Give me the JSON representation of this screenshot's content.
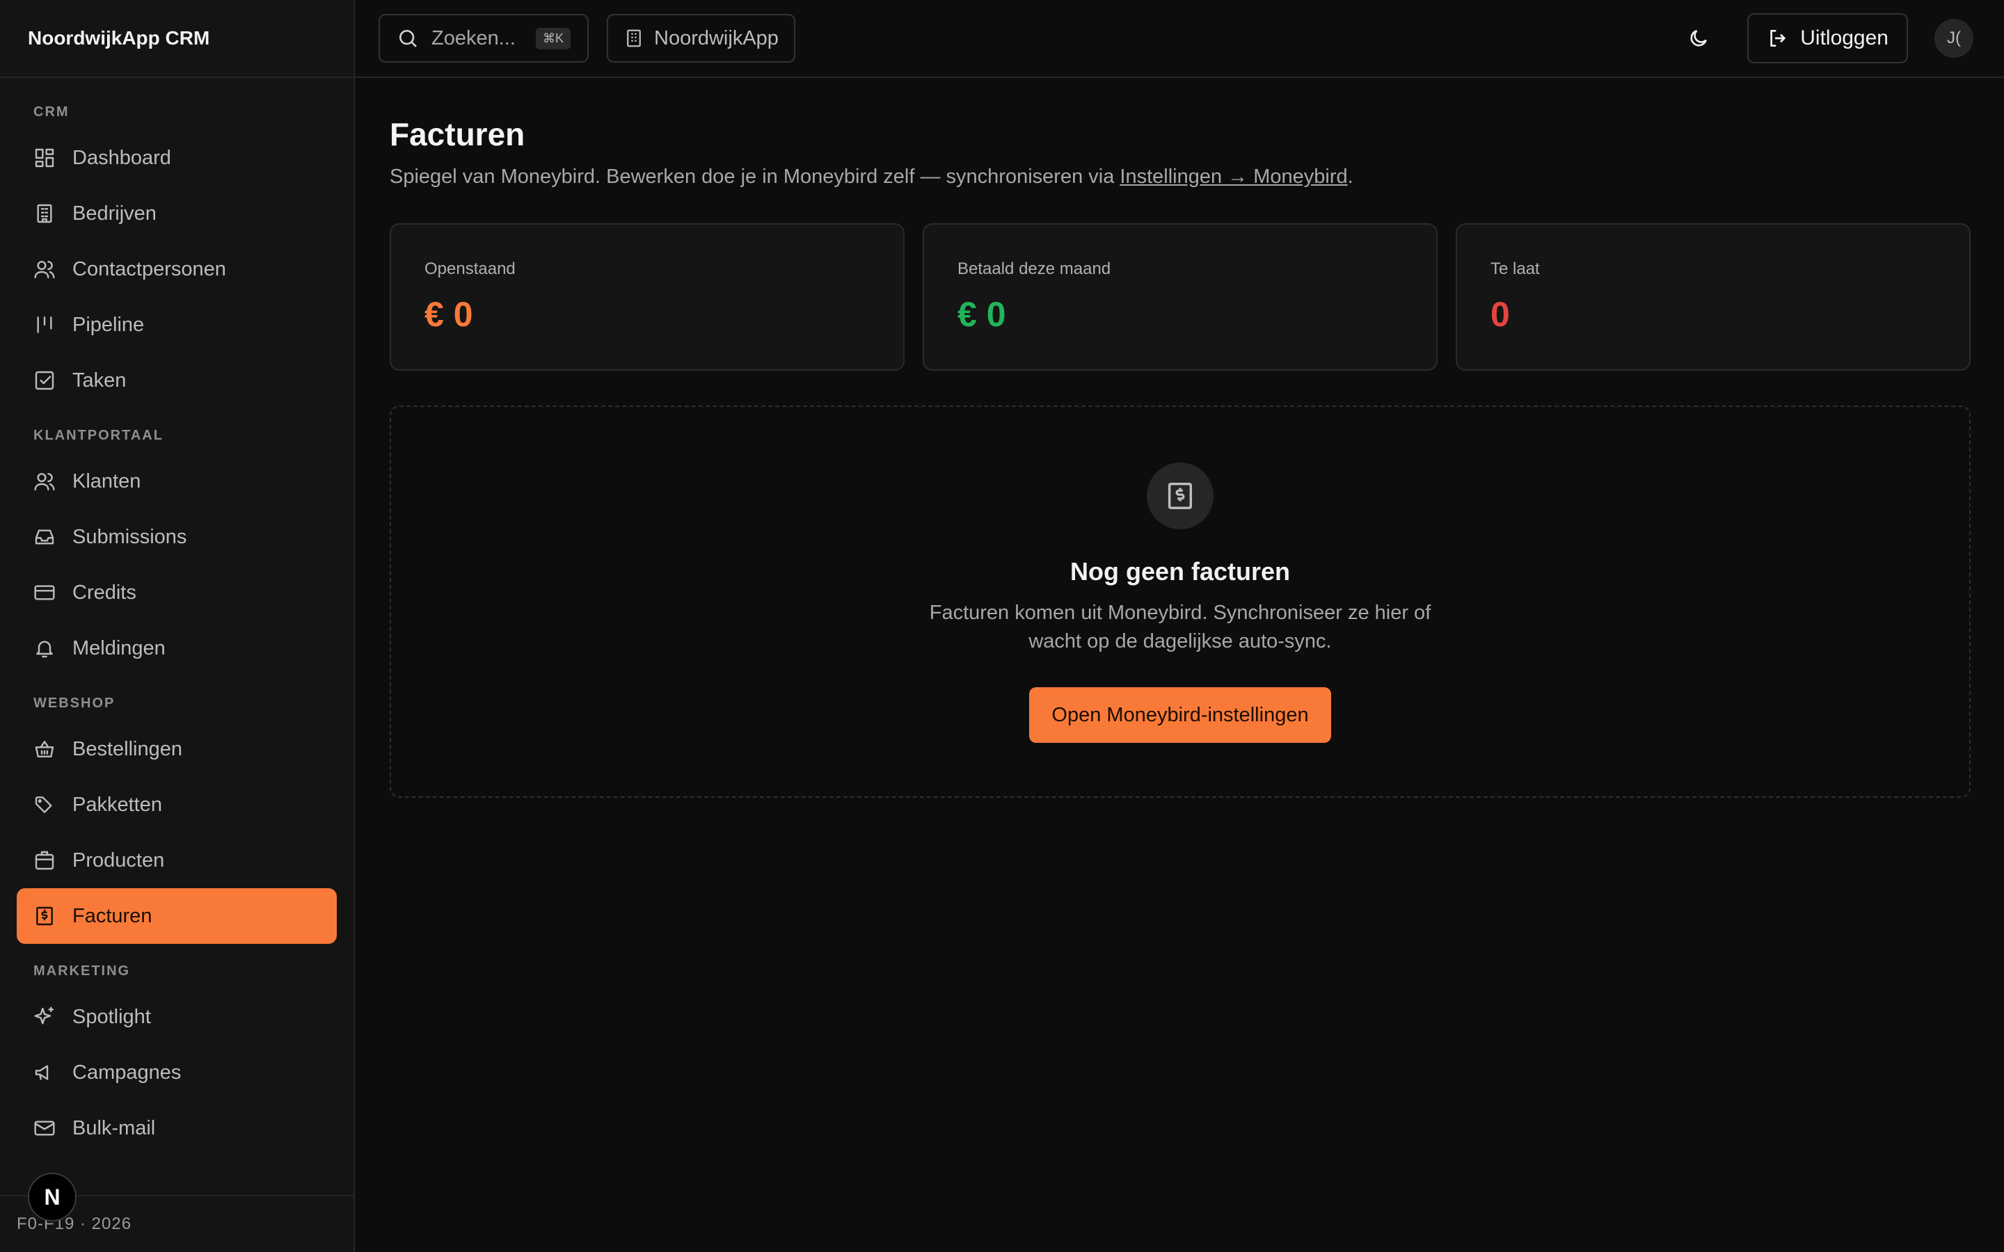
{
  "app": {
    "brand": "NoordwijkApp CRM"
  },
  "sidebar": {
    "sections": [
      {
        "title": "CRM",
        "items": [
          {
            "label": "Dashboard",
            "icon": "dashboard-icon"
          },
          {
            "label": "Bedrijven",
            "icon": "building-icon"
          },
          {
            "label": "Contactpersonen",
            "icon": "users-icon"
          },
          {
            "label": "Pipeline",
            "icon": "pipeline-icon"
          },
          {
            "label": "Taken",
            "icon": "checkbox-icon"
          }
        ]
      },
      {
        "title": "KLANTPORTAAL",
        "items": [
          {
            "label": "Klanten",
            "icon": "users-icon"
          },
          {
            "label": "Submissions",
            "icon": "inbox-icon"
          },
          {
            "label": "Credits",
            "icon": "credit-card-icon"
          },
          {
            "label": "Meldingen",
            "icon": "bell-icon"
          }
        ]
      },
      {
        "title": "WEBSHOP",
        "items": [
          {
            "label": "Bestellingen",
            "icon": "basket-icon"
          },
          {
            "label": "Pakketten",
            "icon": "tags-icon"
          },
          {
            "label": "Producten",
            "icon": "package-icon"
          },
          {
            "label": "Facturen",
            "icon": "receipt-icon",
            "active": true
          }
        ]
      },
      {
        "title": "MARKETING",
        "items": [
          {
            "label": "Spotlight",
            "icon": "sparkles-icon"
          },
          {
            "label": "Campagnes",
            "icon": "megaphone-icon"
          },
          {
            "label": "Bulk-mail",
            "icon": "mail-icon"
          }
        ]
      }
    ],
    "footer_text": "F0-F19 · 2026",
    "badge": "N"
  },
  "header": {
    "search_placeholder": "Zoeken...",
    "search_shortcut": "⌘K",
    "org_name": "NoordwijkApp",
    "logout_label": "Uitloggen",
    "avatar_initials": "J("
  },
  "main": {
    "title": "Facturen",
    "subtitle_prefix": "Spiegel van Moneybird. Bewerken doe je in Moneybird zelf — synchroniseren via ",
    "subtitle_link": "Instellingen → Moneybird",
    "subtitle_suffix": ".",
    "stats": [
      {
        "label": "Openstaand",
        "value": "€ 0",
        "color": "#f97a38"
      },
      {
        "label": "Betaald deze maand",
        "value": "€ 0",
        "color": "#22b45a"
      },
      {
        "label": "Te laat",
        "value": "0",
        "color": "#e5453f"
      }
    ],
    "empty": {
      "title": "Nog geen facturen",
      "text": "Facturen komen uit Moneybird. Synchroniseer ze hier of wacht op de dagelijkse auto-sync.",
      "cta": "Open Moneybird-instellingen"
    }
  },
  "colors": {
    "accent": "#f97a38",
    "background": "#0d0d0d",
    "sidebar": "#141414"
  }
}
